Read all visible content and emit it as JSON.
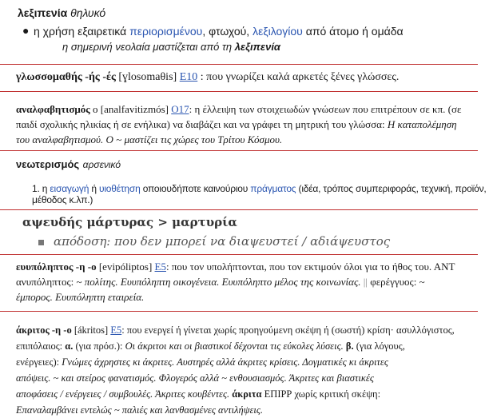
{
  "entry1": {
    "headword": "λεξιπενία",
    "gender": "θηλυκό",
    "def_pre": "η χρήση εξαιρετικά",
    "link1": "περιορισμένου",
    "def_mid1": ", φτωχού,",
    "link2": "λεξιλογίου",
    "def_post": "από άτομο ή ομάδα",
    "example_pre": "η σημερινή νεολαία μαστίζεται από τη",
    "example_bold": "λεξιπενία"
  },
  "entry2": {
    "headword": "γλωσσομαθής -ής -ές",
    "pron": "[ɣlosomaθis]",
    "code": "E10",
    "definition": ": που γνωρίζει καλά αρκετές ξένες γλώσσες."
  },
  "entry3": {
    "headword": "αναλφαβητισμός",
    "article": "ο",
    "pron": "[analfavitizmós]",
    "code": "O17",
    "line1": ": η έλλειψη των στοιχειωδών γνώσεων που επιτρέπουν σε κπ. (σε",
    "line2_pre": "παιδί σχολικής ηλικίας ή σε ενήλικα) να διαβάζει και να γράφει τη μητρική του γλώσσα:",
    "line2_it": "Η καταπολέμηση",
    "line3_it": "του αναλφαβητισμού. Ο ~ μαστίζει τις χώρες του Τρίτου Κόσμου."
  },
  "entry4": {
    "headword": "νεωτερισμός",
    "gender": "αρσενικό",
    "num": "1.",
    "w1": "η",
    "link1": "εισαγωγή",
    "w2": "ή",
    "link2": "υιοθέτηση",
    "w3": "οποιουδήποτε καινούριου",
    "link3": "πράγματος",
    "w4": "(ιδέα, τρόπος συμπεριφοράς, τεχνική, προϊόν, μέθοδος κ.λπ.)"
  },
  "entry5": {
    "headword": "αψευδής μάρτυρας > μαρτυρία",
    "definition": "απόδοση: που δεν μπορεί να διαψευστεί / αδιάψευστος"
  },
  "entry6": {
    "headword": "ευυπόληπτος -η -ο",
    "pron": "[evipóliptos]",
    "code": "E5",
    "line1": ": που τον υπολήπτονται, που τον εκτιμούν όλοι για το ήθος του. ΑΝΤ",
    "line2_pre": "ανυπόληπτος: ~",
    "line2_it": "πολίτης. Ευυπόληπτη οικογένεια. Ευυπόληπτο μέλος της κοινωνίας.",
    "sep": "||",
    "line2_post": "φερέγγυος: ~",
    "line3_it": "έμπορος. Ευυπόληπτη εταιρεία."
  },
  "entry7": {
    "headword": "άκριτος -η -ο",
    "pron": "[ákritos]",
    "code": "E5",
    "line1": ": που ενεργεί ή γίνεται χωρίς προηγούμενη σκέψη ή (σωστή) κρίση· ασυλλόγιστος,",
    "line2_pre": "επιπόλαιος:",
    "line2_a": "α.",
    "line2_mid": "(για πρόσ.):",
    "line2_it": "Οι άκριτοι και οι βιαστικοί δέχονται τις εύκολες λύσεις.",
    "line2_b": "β.",
    "line2_post": "(για λόγους,",
    "line3_pre": "ενέργειες):",
    "line3_it": "Γνώμες άχρηστες κι άκριτες. Αυστηρές αλλά άκριτες κρίσεις. Δογματικές κι άκριτες",
    "line4_it": "απόψεις. ~ και στείρος φανατισμός. Φλογερός αλλά ~ ενθουσιασμός. Άκριτες και βιαστικές",
    "line5_it": "αποφάσεις / ενέργειες / συμβουλές. Άκριτες κουβέντες.",
    "line5_bold": "άκριτα",
    "line5_post": "ΕΠΙΡΡ χωρίς κριτική σκέψη:",
    "line6_it": "Επαναλαμβάνει εντελώς ~ παλιές και λανθασμένες αντιλήψεις."
  },
  "colors": {
    "rule": "#c03030",
    "link": "#2a55b0"
  }
}
